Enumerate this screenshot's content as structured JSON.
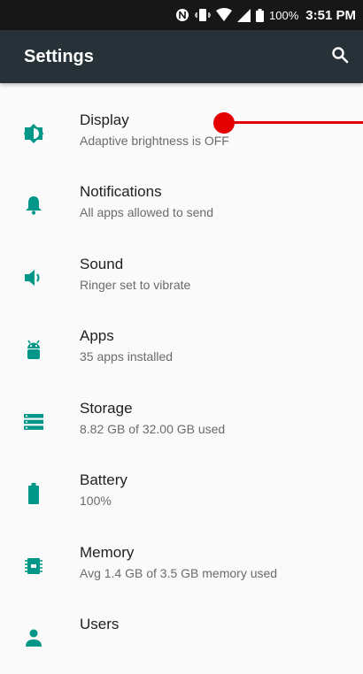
{
  "status_bar": {
    "battery_percent": "100%",
    "time": "3:51 PM",
    "icons": [
      "nfc-icon",
      "vibrate-icon",
      "wifi-icon",
      "signal-icon",
      "battery-icon"
    ]
  },
  "app_bar": {
    "title": "Settings",
    "search_icon": "search-icon"
  },
  "settings": [
    {
      "title": "Display",
      "summary": "Adaptive brightness is OFF",
      "icon": "brightness-icon"
    },
    {
      "title": "Notifications",
      "summary": "All apps allowed to send",
      "icon": "bell-icon"
    },
    {
      "title": "Sound",
      "summary": "Ringer set to vibrate",
      "icon": "volume-icon"
    },
    {
      "title": "Apps",
      "summary": "35 apps installed",
      "icon": "android-icon"
    },
    {
      "title": "Storage",
      "summary": "8.82 GB of 32.00 GB used",
      "icon": "storage-icon"
    },
    {
      "title": "Battery",
      "summary": "100%",
      "icon": "battery-icon"
    },
    {
      "title": "Memory",
      "summary": "Avg 1.4 GB of 3.5 GB memory used",
      "icon": "memory-icon"
    },
    {
      "title": "Users",
      "summary": "",
      "icon": "person-icon"
    }
  ],
  "colors": {
    "accent": "#009688",
    "app_bar": "#263238",
    "status_bar": "#171717",
    "touch_indicator": "#e50000"
  }
}
